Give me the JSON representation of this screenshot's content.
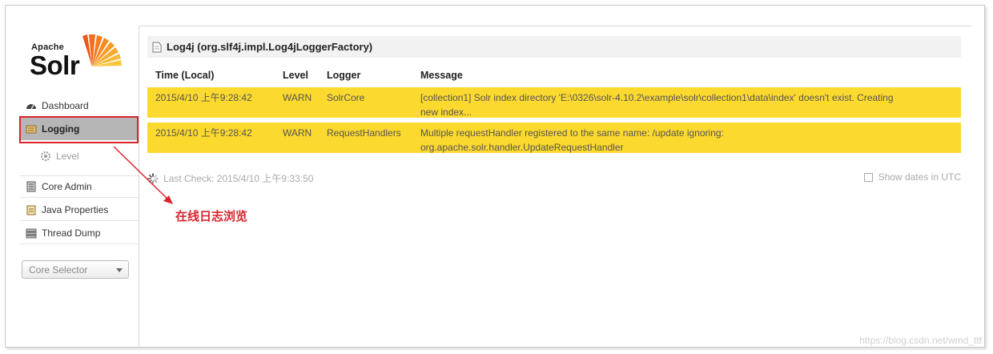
{
  "app": {
    "logo_top": "Apache",
    "logo_main": "Solr"
  },
  "sidebar": {
    "items": [
      {
        "label": "Dashboard",
        "icon": "dashboard-icon"
      },
      {
        "label": "Logging",
        "icon": "logging-icon",
        "active": true
      },
      {
        "label": "Level",
        "icon": "gear-icon",
        "sub": true
      },
      {
        "label": "Core Admin",
        "icon": "core-admin-icon"
      },
      {
        "label": "Java Properties",
        "icon": "java-properties-icon"
      },
      {
        "label": "Thread Dump",
        "icon": "thread-dump-icon"
      }
    ],
    "core_selector": "Core Selector"
  },
  "main": {
    "title": "Log4j (org.slf4j.impl.Log4jLoggerFactory)",
    "columns": [
      "Time (Local)",
      "Level",
      "Logger",
      "Message"
    ],
    "rows": [
      {
        "time": "2015/4/10 上午9:28:42",
        "level": "WARN",
        "logger": "SolrCore",
        "message_line1": "[collection1] Solr index directory 'E:\\0326\\solr-4.10.2\\example\\solr\\collection1\\data\\index' doesn't exist. Creating",
        "message_line2": "new index..."
      },
      {
        "time": "2015/4/10 上午9:28:42",
        "level": "WARN",
        "logger": "RequestHandlers",
        "message_line1": "Multiple requestHandler registered to the same name: /update ignoring:",
        "message_line2": "org.apache.solr.handler.UpdateRequestHandler"
      }
    ],
    "last_check": "Last Check: 2015/4/10 上午9:33:50",
    "show_dates_utc": "Show dates in UTC"
  },
  "annotation": {
    "text": "在线日志浏览",
    "color": "#d9242c"
  },
  "watermark": "https://blog.csdn.net/wmd_ttf",
  "colors": {
    "warn_row": "#fcd92e",
    "active_nav": "#b6b6b6"
  }
}
